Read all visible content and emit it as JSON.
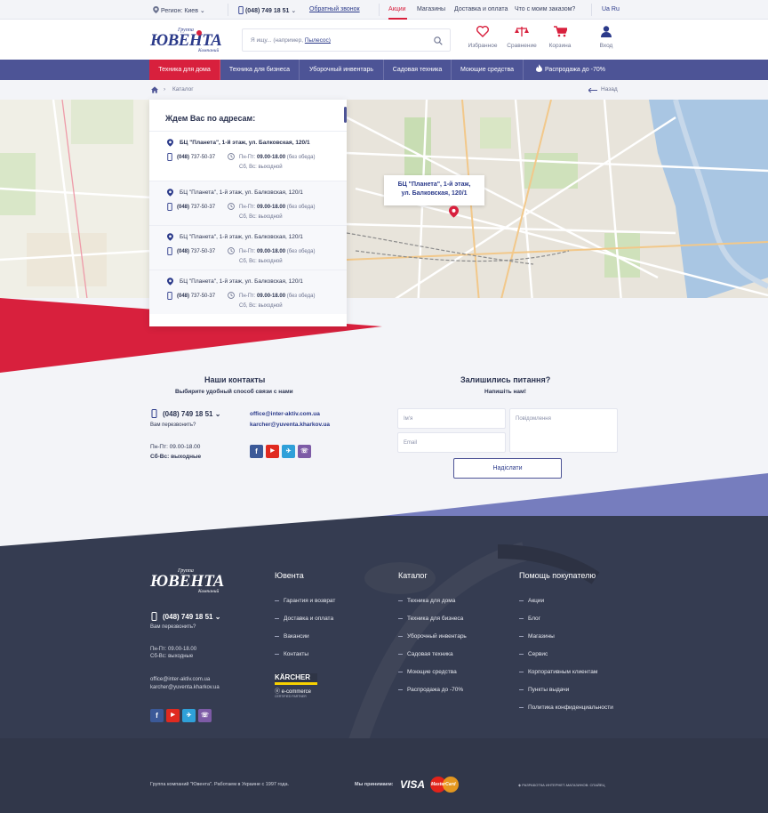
{
  "topbar": {
    "region": "Регион: Киев",
    "phone": "(048) 749 18 51",
    "callback": "Обратный звонок",
    "links": [
      "Акции",
      "Магазины",
      "Доставка и оплата",
      "Что с моим заказом?"
    ],
    "langs": "Ua Ru"
  },
  "header": {
    "logo_top": "Группа",
    "logo_main": "ЮВЕНТА",
    "logo_bottom": "Компаний",
    "search_placeholder": "Я ищу... (например,",
    "search_example": "Пылесос)",
    "icons": [
      {
        "icon": "heart-icon",
        "label": "Избранное"
      },
      {
        "icon": "compare-icon",
        "label": "Сравнение"
      },
      {
        "icon": "cart-icon",
        "label": "Корзина"
      },
      {
        "icon": "user-icon",
        "label": "Вход"
      }
    ]
  },
  "nav": {
    "items": [
      "Техника для дома",
      "Техника для бизнеса",
      "Уборочный инвентарь",
      "Садовая техника",
      "Моющие средства",
      "Распродажа до -70%"
    ]
  },
  "breadcrumb": {
    "current": "Каталог",
    "back": "Назад"
  },
  "addresses": {
    "title": "Ждем Вас по адресам:",
    "items": [
      {
        "title": "БЦ \"Планета\", 1-й этаж, ул. Балковская, 120/1",
        "phone_prefix": "(048)",
        "phone": "737-50-37",
        "hours_label": "Пн-Пт:",
        "hours": "09.00-18.00",
        "hours_note": "(без обеда)",
        "weekend": "Сб, Вс: выходной"
      },
      {
        "title": "БЦ \"Планета\", 1-й этаж, ул. Балковская, 120/1",
        "phone_prefix": "(048)",
        "phone": "737-50-37",
        "hours_label": "Пн-Пт:",
        "hours": "09.00-18.00",
        "hours_note": "(без обеда)",
        "weekend": "Сб, Вс: выходной"
      },
      {
        "title": "БЦ \"Планета\", 1-й этаж, ул. Балковская, 120/1",
        "phone_prefix": "(048)",
        "phone": "737-50-37",
        "hours_label": "Пн-Пт:",
        "hours": "09.00-18.00",
        "hours_note": "(без обеда)",
        "weekend": "Сб, Вс: выходной"
      },
      {
        "title": "БЦ \"Планета\", 1-й этаж, ул. Балковская, 120/1",
        "phone_prefix": "(048)",
        "phone": "737-50-37",
        "hours_label": "Пн-Пт:",
        "hours": "09.00-18.00",
        "hours_note": "(без обеда)",
        "weekend": "Сб, Вс: выходной"
      }
    ],
    "map_tooltip_line1": "БЦ \"Планета\", 1-й этаж,",
    "map_tooltip_line2": "ул. Балковская, 120/1"
  },
  "contacts": {
    "title": "Наши контакты",
    "subtitle": "Выбирите удобный способ связи с нами",
    "phone": "(048) 749 18 51",
    "callback": "Вам перезвонить?",
    "hours": "Пн-Пт: 09.00-18.00",
    "weekend": "Сб-Вс: выходные",
    "emails": [
      "office@inter-aktiv.com.ua",
      "karcher@yuventa.kharkov.ua"
    ],
    "social": [
      "f",
      "▶",
      "✈",
      "☏"
    ]
  },
  "form": {
    "title": "Залишились питання?",
    "subtitle": "Напишіть нам!",
    "name_ph": "Ім'я",
    "message_ph": "Повідомлення",
    "email_ph": "Email",
    "submit": "Надіслати"
  },
  "footer": {
    "phone": "(048) 749 18 51",
    "callback": "Вам перезвонить?",
    "hours": "Пн-Пт: 09.00-18.00",
    "weekend": "Сб-Вс: выходные",
    "emails": [
      "office@inter-aktiv.com.ua",
      "karcher@yuventa.kharkov.ua"
    ],
    "col1": {
      "title": "Ювента",
      "links": [
        "Гарантия и возврат",
        "Доставка и оплата",
        "Вакансии",
        "Контакты"
      ]
    },
    "col2": {
      "title": "Каталог",
      "links": [
        "Техника для дома",
        "Техника для бизнеса",
        "Уборочный инвентарь",
        "Садовая техника",
        "Моющие средства",
        "Распродажа до -70%"
      ]
    },
    "col3": {
      "title": "Помощь покупателю",
      "links": [
        "Акции",
        "Блог",
        "Магазины",
        "Сервис",
        "Корпоративным клиентам",
        "Пункты выдачи",
        "Политика конфиденциальности"
      ]
    },
    "karcher": "KÄRCHER",
    "ecommerce": "e-commerce",
    "certified": "CERTIFIED PARTNER",
    "copyright": "Группа компаний \"Ювента\". Работаем в Украине с 1997 года.",
    "we_accept": "Мы принимаем:",
    "visa": "VISA",
    "mastercard": "MasterCard",
    "dev": "РАЗРАБОТКА ИНТЕРНЕТ-МАГАЗИНОВ: СПАЙЕЦ"
  },
  "colors": {
    "accent": "#d8203d",
    "nav": "#4d5496",
    "footer": "#333a4f",
    "text": "#2b3350"
  }
}
